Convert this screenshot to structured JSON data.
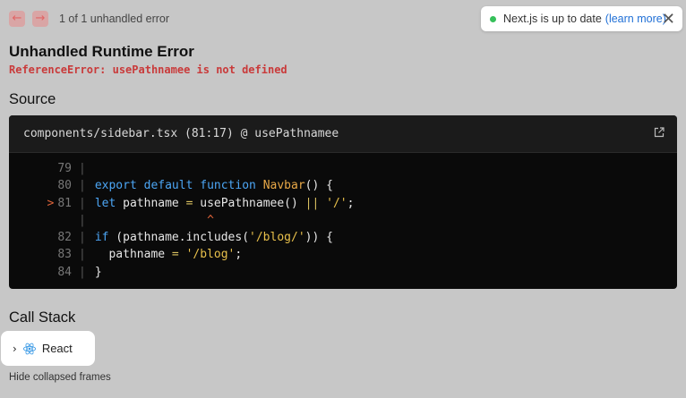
{
  "nav": {
    "prev_icon": "arrow-left-icon",
    "next_icon": "arrow-right-icon",
    "prev_glyph": "←",
    "next_glyph": "→"
  },
  "error_count": "1 of 1 unhandled error",
  "toast": {
    "status_color": "#36c05a",
    "text": "Next.js is up to date",
    "link": "(learn more)",
    "close_glyph": "✕"
  },
  "error": {
    "title": "Unhandled Runtime Error",
    "message": "ReferenceError: usePathnamee is not defined"
  },
  "source": {
    "heading": "Source",
    "file": "components/sidebar.tsx (81:17) @ usePathnamee",
    "lines": {
      "l79": {
        "num": "79"
      },
      "l80": {
        "num": "80",
        "kw1": "export",
        "kw2": "default",
        "kw3": "function",
        "fn": "Navbar",
        "rest": "() {"
      },
      "l81": {
        "marker": ">",
        "num": "81",
        "kw": "let",
        "a": " pathname ",
        "eq": "=",
        "b": " usePathnamee() ",
        "or": "||",
        "c": " ",
        "str": "'/'",
        "d": ";"
      },
      "caret": {
        "glyph": "^"
      },
      "l82": {
        "num": "82",
        "kw": "if",
        "a": " (pathname.includes(",
        "str": "'/blog/'",
        "b": ")) {"
      },
      "l83": {
        "num": "83",
        "a": "  pathname ",
        "eq": "=",
        "b": " ",
        "str": "'/blog'",
        "c": ";"
      },
      "l84": {
        "num": "84",
        "a": "}"
      }
    }
  },
  "call_stack": {
    "heading": "Call Stack",
    "group_chevron": "›",
    "group_label": "React",
    "hide_label": "Hide collapsed frames"
  }
}
